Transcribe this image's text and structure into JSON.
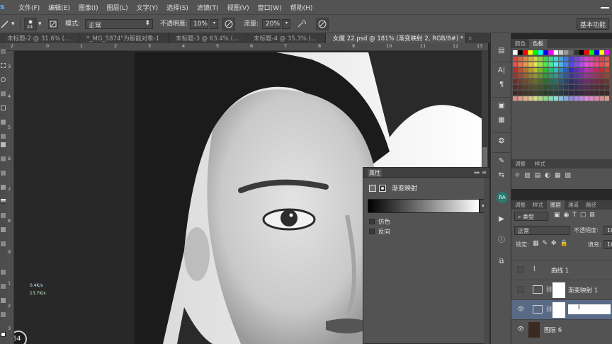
{
  "menu": {
    "logo": "s",
    "items": [
      "文件(F)",
      "编辑(E)",
      "图像(I)",
      "图层(L)",
      "文字(Y)",
      "选择(S)",
      "滤镜(T)",
      "视图(V)",
      "窗口(W)",
      "帮助(H)"
    ]
  },
  "options": {
    "brush_size": "24",
    "mode_label": "模式:",
    "mode_value": "正常",
    "opacity_label": "不透明度:",
    "opacity_value": "10%",
    "flow_label": "流量:",
    "flow_value": "20%",
    "workspace": "基本功能"
  },
  "tabs": [
    {
      "label": "未标题-2 @ 31.6% (...",
      "active": false
    },
    {
      "label": "*_MG_5874\"为智能对象-1",
      "active": false
    },
    {
      "label": "未标题-3 @ 63.4% (...",
      "active": false
    },
    {
      "label": "未标题-4 @ 35.3% (...",
      "active": false
    },
    {
      "label": "女魔 22.psd @ 181% (渐变映射 2, RGB/8#) *",
      "active": true
    }
  ],
  "ruler_top": [
    "2",
    "0",
    "1",
    "2",
    "3",
    "4",
    "5",
    "6",
    "7",
    "8",
    "9",
    "10",
    "11",
    "12",
    "13"
  ],
  "ruler_left": [
    "3",
    "4",
    "5",
    "6",
    "7",
    "8",
    "9",
    "1",
    "2",
    "3"
  ],
  "navigator": {
    "percent": "64",
    "speed_up": "0.4K/s",
    "speed_down": "13.7K/s"
  },
  "properties": {
    "tab": "属性",
    "title": "渐变映射",
    "dither_label": "仿色",
    "reverse_label": "反向"
  },
  "color_panel": {
    "tabs": [
      "颜色",
      "色板"
    ]
  },
  "adjust_tabs": [
    "调整",
    "样式"
  ],
  "layers_panel": {
    "tabs": [
      "图层",
      "通道",
      "路径"
    ],
    "filter": "类型",
    "blend_mode": "正常",
    "opacity_label": "不透明度:",
    "opacity_value": "10",
    "lock_label": "锁定:",
    "fill_label": "填充:",
    "fill_value": "10",
    "layers": [
      {
        "name": "曲线 1",
        "visible": false,
        "selected": false,
        "kind": "curves"
      },
      {
        "name": "渐变映射 1",
        "visible": false,
        "selected": false,
        "kind": "gradient"
      },
      {
        "name": "",
        "visible": true,
        "selected": true,
        "kind": "gradient",
        "cursor": "I"
      },
      {
        "name": "图层 6",
        "visible": true,
        "selected": false,
        "kind": "photo"
      }
    ]
  }
}
